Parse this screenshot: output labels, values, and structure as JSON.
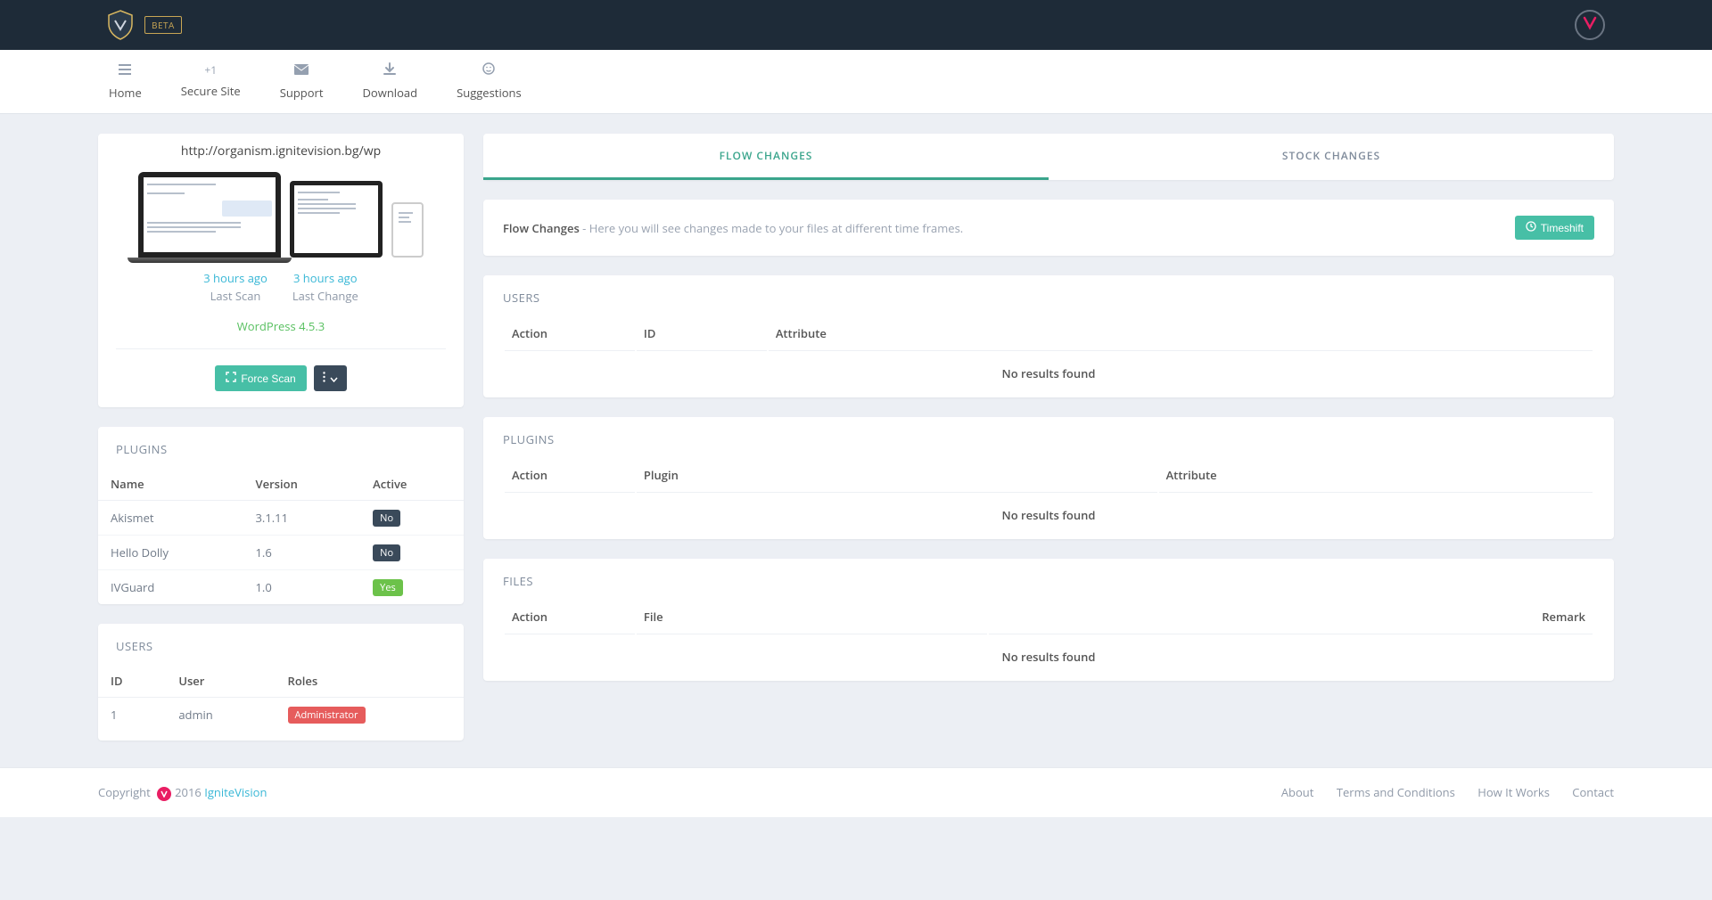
{
  "header": {
    "beta": "BETA"
  },
  "nav": {
    "home": "Home",
    "secure": "Secure Site",
    "support": "Support",
    "download": "Download",
    "suggestions": "Suggestions",
    "plus": "+1"
  },
  "site": {
    "url": "http://organism.ignitevision.bg/wp",
    "last_scan_ago": "3 hours ago",
    "last_scan_label": "Last Scan",
    "last_change_ago": "3 hours ago",
    "last_change_label": "Last Change",
    "cms": "WordPress 4.5.3",
    "force_scan": "Force Scan"
  },
  "plugins": {
    "title": "PLUGINS",
    "cols": {
      "name": "Name",
      "version": "Version",
      "active": "Active"
    },
    "rows": [
      {
        "name": "Akismet",
        "version": "3.1.11",
        "active": "No",
        "active_style": "dark"
      },
      {
        "name": "Hello Dolly",
        "version": "1.6",
        "active": "No",
        "active_style": "dark"
      },
      {
        "name": "IVGuard",
        "version": "1.0",
        "active": "Yes",
        "active_style": "green"
      }
    ]
  },
  "users_sidebar": {
    "title": "USERS",
    "cols": {
      "id": "ID",
      "user": "User",
      "roles": "Roles"
    },
    "rows": [
      {
        "id": "1",
        "user": "admin",
        "role": "Administrator"
      }
    ]
  },
  "tabs": {
    "flow": "FLOW CHANGES",
    "stock": "STOCK CHANGES"
  },
  "infobar": {
    "title": "Flow Changes",
    "desc": " - Here you will see changes made to your files at different time frames.",
    "timeshift": "Timeshift"
  },
  "sections": {
    "users": {
      "title": "USERS",
      "cols": {
        "action": "Action",
        "id": "ID",
        "attribute": "Attribute"
      },
      "empty": "No results found"
    },
    "plugins": {
      "title": "PLUGINS",
      "cols": {
        "action": "Action",
        "plugin": "Plugin",
        "attribute": "Attribute"
      },
      "empty": "No results found"
    },
    "files": {
      "title": "FILES",
      "cols": {
        "action": "Action",
        "file": "File",
        "remark": "Remark"
      },
      "empty": "No results found"
    }
  },
  "footer": {
    "copyright_prefix": "Copyright ",
    "year": "2016 ",
    "brand": "IgniteVision",
    "links": {
      "about": "About",
      "terms": "Terms and Conditions",
      "how": "How It Works",
      "contact": "Contact"
    }
  }
}
